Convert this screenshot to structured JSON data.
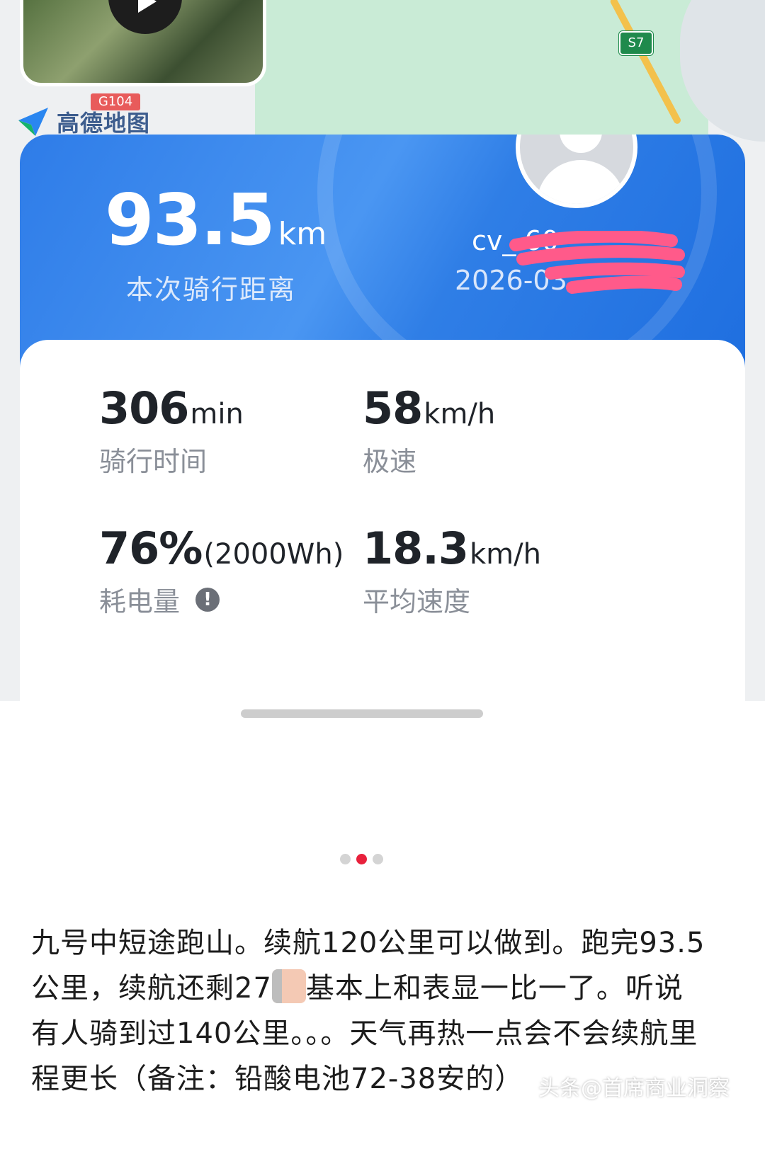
{
  "map": {
    "logo_name": "高德地图",
    "road_badge": "S7",
    "road_sign": "G104"
  },
  "ride": {
    "distance_value": "93.5",
    "distance_unit": "km",
    "distance_label": "本次骑行距离",
    "user_id": "cv_  60",
    "date": "2026-03"
  },
  "stats": {
    "ride_time_value": "306",
    "ride_time_unit": "min",
    "ride_time_label": "骑行时间",
    "top_speed_value": "58",
    "top_speed_unit": "km/h",
    "top_speed_label": "极速",
    "battery_value": "76%",
    "battery_unit": "(2000Wh)",
    "battery_label": "耗电量",
    "avg_speed_value": "18.3",
    "avg_speed_unit": "km/h",
    "avg_speed_label": "平均速度"
  },
  "carousel": {
    "count": 3,
    "active_index": 1
  },
  "post": {
    "text_part1": "九号中短途跑山。续航120公里可以做到。跑完93.5公里，续航还剩27",
    "text_part2": "基本上和表显一比一了。听说有人骑到过140公里。。。天气再热一点会不会续航里程更长（备注：铅酸电池72-38安的）"
  },
  "watermark": "头条@首席商业洞察",
  "colors": {
    "card_blue": "#2e7ce8",
    "active_dot": "#e8213c",
    "redaction": "#ff5a8a"
  }
}
